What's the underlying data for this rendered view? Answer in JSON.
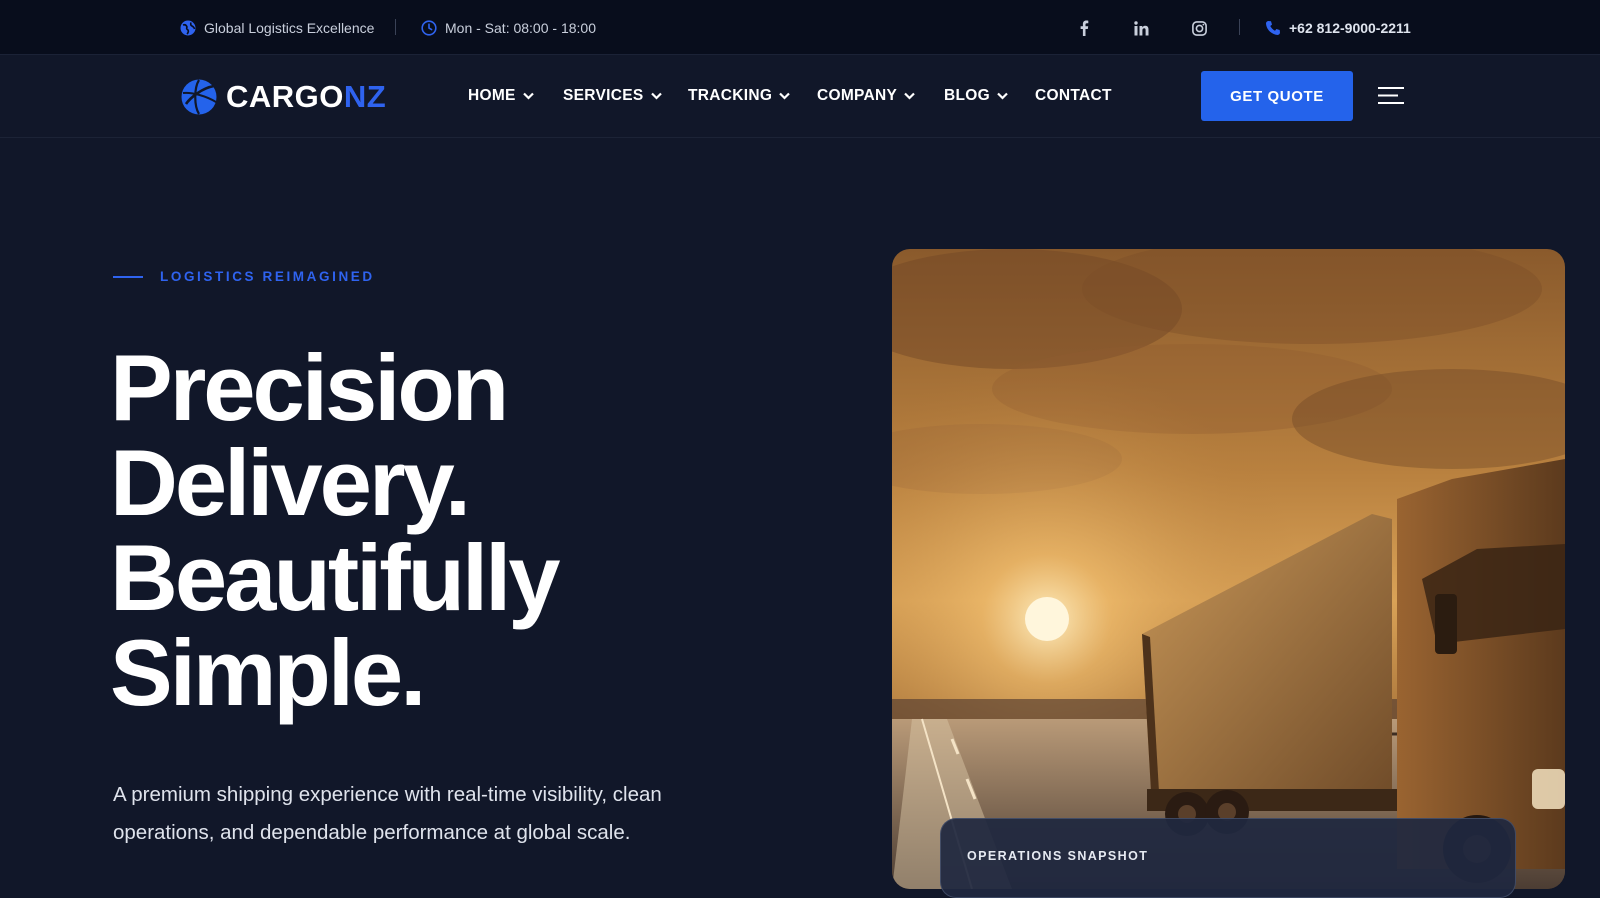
{
  "topbar": {
    "tagline": "Global Logistics Excellence",
    "hours": "Mon - Sat: 08:00 - 18:00",
    "phone": "+62 812-9000-2211",
    "social": [
      "facebook-icon",
      "linkedin-icon",
      "instagram-icon"
    ]
  },
  "brand": {
    "name_part1": "CARGO",
    "name_part2": "NZ",
    "accent_color": "#2463eb"
  },
  "nav": {
    "items": [
      {
        "label": "HOME",
        "has_dropdown": true
      },
      {
        "label": "SERVICES",
        "has_dropdown": true
      },
      {
        "label": "TRACKING",
        "has_dropdown": true
      },
      {
        "label": "COMPANY",
        "has_dropdown": true
      },
      {
        "label": "BLOG",
        "has_dropdown": true
      },
      {
        "label": "CONTACT",
        "has_dropdown": false
      }
    ],
    "cta_label": "GET QUOTE"
  },
  "hero": {
    "eyebrow": "LOGISTICS REIMAGINED",
    "headline_lines": [
      "Precision",
      "Delivery.",
      "Beautifully",
      "Simple."
    ],
    "subtitle": "A premium shipping experience with real-time visibility, clean operations, and dependable performance at global scale.",
    "card_label": "OPERATIONS SNAPSHOT"
  },
  "colors": {
    "background": "#111729",
    "topbar": "#080d1c",
    "accent": "#2f63ef"
  }
}
